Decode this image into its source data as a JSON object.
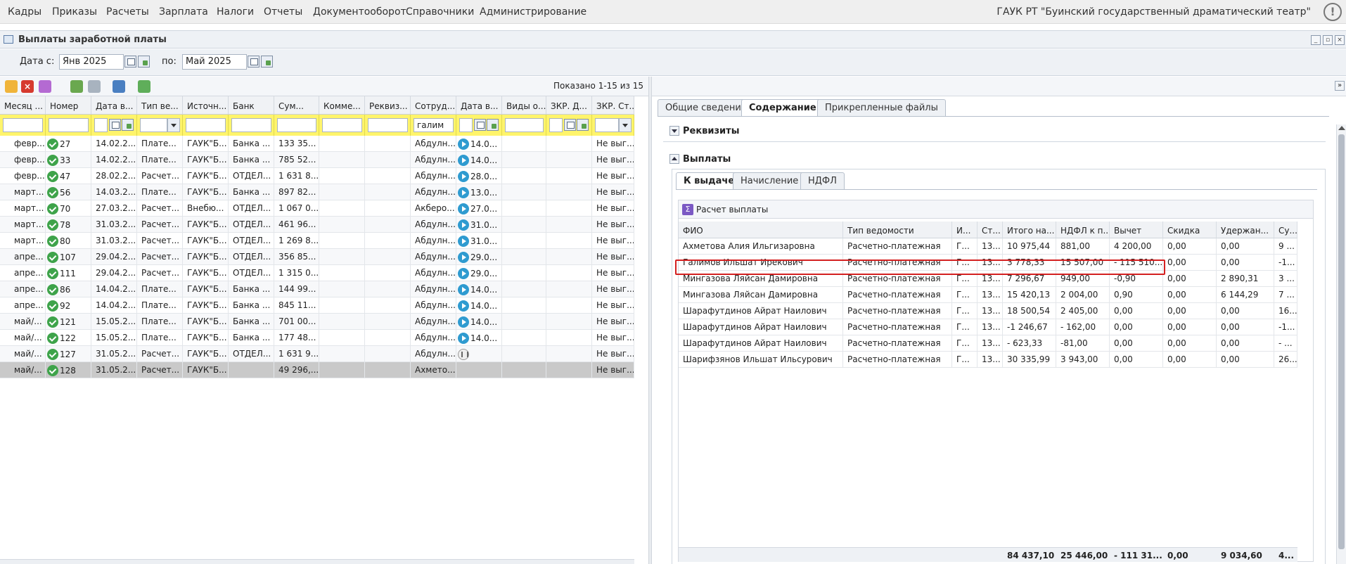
{
  "menu": [
    "Кадры",
    "Приказы",
    "Расчеты",
    "Зарплата",
    "Налоги",
    "Отчеты",
    "Документооборот",
    "Справочники",
    "Администрирование"
  ],
  "org": "ГАУК РТ \"Буинский государственный драматический театр\"",
  "window": {
    "title": "Выплаты заработной платы"
  },
  "dates": {
    "from_label": "Дата с:",
    "from_value": "Янв 2025",
    "to_label": "по:",
    "to_value": "Май 2025"
  },
  "toolbar": {
    "shown": "Показано 1-15 из 15"
  },
  "grid": {
    "headers": [
      "Месяц ...",
      "Номер",
      "Дата в...",
      "Тип ве...",
      "Источн...",
      "Банк",
      "Сум...",
      "Комме...",
      "Реквиз...",
      "Сотруд...",
      "Дата в...",
      "Виды о...",
      "ЗКР. Д...",
      "ЗКР. Ст..."
    ],
    "filter_employee": "галим",
    "rows": [
      [
        "февр...",
        "27",
        "14.02.2...",
        "Плате...",
        "ГАУК\"Б...",
        "Банка ...",
        "133 35...",
        "",
        "",
        "Абдулн...",
        "14.0...",
        "",
        "",
        "Не выг...",
        "check",
        "play"
      ],
      [
        "февр...",
        "33",
        "14.02.2...",
        "Плате...",
        "ГАУК\"Б...",
        "Банка ...",
        "785 52...",
        "",
        "",
        "Абдулн...",
        "14.0...",
        "",
        "",
        "Не выг...",
        "check",
        "play"
      ],
      [
        "февр...",
        "47",
        "28.02.2...",
        "Расчет...",
        "ГАУК\"Б...",
        "ОТДЕЛ...",
        "1 631 8...",
        "",
        "",
        "Абдулн...",
        "28.0...",
        "",
        "",
        "Не выг...",
        "check",
        "play"
      ],
      [
        "март...",
        "56",
        "14.03.2...",
        "Плате...",
        "ГАУК\"Б...",
        "Банка ...",
        "897 82...",
        "",
        "",
        "Абдулн...",
        "13.0...",
        "",
        "",
        "Не выг...",
        "check",
        "play"
      ],
      [
        "март...",
        "70",
        "27.03.2...",
        "Расчет...",
        "Внебю...",
        "ОТДЕЛ...",
        "1 067 0...",
        "",
        "",
        "Акберо...",
        "27.0...",
        "",
        "",
        "Не выг...",
        "check",
        "play"
      ],
      [
        "март...",
        "78",
        "31.03.2...",
        "Расчет...",
        "ГАУК\"Б...",
        "ОТДЕЛ...",
        "461 96...",
        "",
        "",
        "Абдулн...",
        "31.0...",
        "",
        "",
        "Не выг...",
        "check",
        "play"
      ],
      [
        "март...",
        "80",
        "31.03.2...",
        "Расчет...",
        "ГАУК\"Б...",
        "ОТДЕЛ...",
        "1 269 8...",
        "",
        "",
        "Абдулн...",
        "31.0...",
        "",
        "",
        "Не выг...",
        "check",
        "play"
      ],
      [
        "апре...",
        "107",
        "29.04.2...",
        "Расчет...",
        "ГАУК\"Б...",
        "ОТДЕЛ...",
        "356 85...",
        "",
        "",
        "Абдулн...",
        "29.0...",
        "",
        "",
        "Не выг...",
        "check",
        "play"
      ],
      [
        "апре...",
        "111",
        "29.04.2...",
        "Расчет...",
        "ГАУК\"Б...",
        "ОТДЕЛ...",
        "1 315 0...",
        "",
        "",
        "Абдулн...",
        "29.0...",
        "",
        "",
        "Не выг...",
        "check",
        "play"
      ],
      [
        "апре...",
        "86",
        "14.04.2...",
        "Плате...",
        "ГАУК\"Б...",
        "Банка ...",
        "144 99...",
        "",
        "",
        "Абдулн...",
        "14.0...",
        "",
        "",
        "Не выг...",
        "check",
        "play"
      ],
      [
        "апре...",
        "92",
        "14.04.2...",
        "Плате...",
        "ГАУК\"Б...",
        "Банка ...",
        "845 11...",
        "",
        "",
        "Абдулн...",
        "14.0...",
        "",
        "",
        "Не выг...",
        "check",
        "play"
      ],
      [
        "май/...",
        "121",
        "15.05.2...",
        "Плате...",
        "ГАУК\"Б...",
        "Банка ...",
        "701 00...",
        "",
        "",
        "Абдулн...",
        "14.0...",
        "",
        "",
        "Не выг...",
        "check",
        "play"
      ],
      [
        "май/...",
        "122",
        "15.05.2...",
        "Плате...",
        "ГАУК\"Б...",
        "Банка ...",
        "177 48...",
        "",
        "",
        "Абдулн...",
        "14.0...",
        "",
        "",
        "Не выг...",
        "check",
        "play"
      ],
      [
        "май/...",
        "127",
        "31.05.2...",
        "Расчет...",
        "ГАУК\"Б...",
        "ОТДЕЛ...",
        "1 631 9...",
        "",
        "",
        "Абдулн...",
        "",
        "",
        "",
        "Не выг...",
        "check",
        "pause"
      ],
      [
        "май/...",
        "128",
        "31.05.2...",
        "Расчет...",
        "ГАУК\"Б...",
        "",
        "49 296,...",
        "",
        "",
        "Ахмето...",
        "",
        "",
        "",
        "Не выг...",
        "check",
        "none"
      ]
    ]
  },
  "right": {
    "tabs": [
      "Общие сведения",
      "Содержание",
      "Прикрепленные файлы"
    ],
    "sec1": "Реквизиты",
    "sec2": "Выплаты",
    "subtabs": [
      "К выдаче",
      "Начисление",
      "НДФЛ"
    ],
    "calc_button": "Расчет выплаты",
    "headers": [
      "ФИО",
      "Тип ведомости",
      "И...",
      "Ст...",
      "Итого на...",
      "НДФЛ к п...",
      "Вычет",
      "Скидка",
      "Удержан...",
      "Су..."
    ],
    "rows": [
      [
        "Ахметова Алия Ильгизаровна",
        "Расчетно-платежная",
        "Г...",
        "13...",
        "10 975,44",
        "881,00",
        "4 200,00",
        "0,00",
        "0,00",
        "9 ..."
      ],
      [
        "Галимов Ильшат Ирекович",
        "Расчетно-платежная",
        "Г...",
        "13...",
        "3 778,33",
        "15 507,00",
        "- 115 510...",
        "0,00",
        "0,00",
        "-1..."
      ],
      [
        "Мингазова Ляйсан Дамировна",
        "Расчетно-платежная",
        "Г...",
        "13...",
        "7 296,67",
        "949,00",
        "-0,90",
        "0,00",
        "2 890,31",
        "3 ..."
      ],
      [
        "Мингазова Ляйсан Дамировна",
        "Расчетно-платежная",
        "Г...",
        "13...",
        "15 420,13",
        "2 004,00",
        "0,90",
        "0,00",
        "6 144,29",
        "7 ..."
      ],
      [
        "Шарафутдинов Айрат Наилович",
        "Расчетно-платежная",
        "Г...",
        "13...",
        "18 500,54",
        "2 405,00",
        "0,00",
        "0,00",
        "0,00",
        "16..."
      ],
      [
        "Шарафутдинов Айрат Наилович",
        "Расчетно-платежная",
        "Г...",
        "13...",
        "-1 246,67",
        "- 162,00",
        "0,00",
        "0,00",
        "0,00",
        "-1..."
      ],
      [
        "Шарафутдинов Айрат Наилович",
        "Расчетно-платежная",
        "Г...",
        "13...",
        "- 623,33",
        "-81,00",
        "0,00",
        "0,00",
        "0,00",
        "- ..."
      ],
      [
        "Шарифзянов Ильшат Ильсурович",
        "Расчетно-платежная",
        "Г...",
        "13...",
        "30 335,99",
        "3 943,00",
        "0,00",
        "0,00",
        "0,00",
        "26..."
      ]
    ],
    "totals": [
      "84 437,10",
      "25 446,00",
      "- 111 31...",
      "0,00",
      "9 034,60",
      "4..."
    ]
  }
}
